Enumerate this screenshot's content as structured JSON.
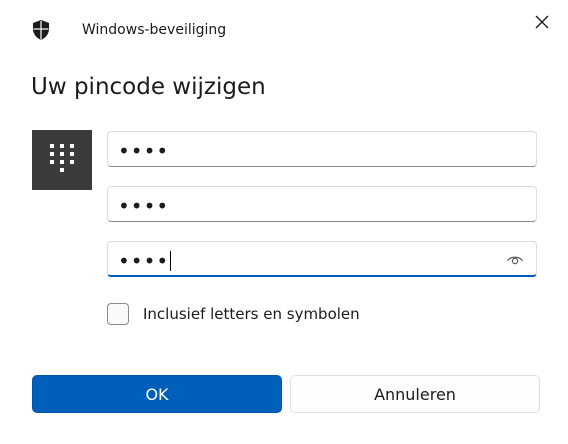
{
  "window": {
    "app_title": "Windows-beveiliging",
    "close_icon": "close-icon",
    "shield_icon": "shield-icon"
  },
  "dialog": {
    "heading": "Uw pincode wijzigen",
    "keypad_icon": "keypad-icon",
    "fields": [
      {
        "name": "current-pin",
        "value": "••••"
      },
      {
        "name": "new-pin",
        "value": "••••"
      },
      {
        "name": "confirm-pin",
        "value": "••••",
        "focused": true,
        "reveal_icon": "eye-icon"
      }
    ],
    "checkbox": {
      "label": "Inclusief letters en symbolen",
      "checked": false
    },
    "buttons": {
      "ok": "OK",
      "cancel": "Annuleren"
    }
  },
  "colors": {
    "accent": "#005fb8",
    "tile": "#3b3b3b",
    "background": "#ffffff"
  }
}
